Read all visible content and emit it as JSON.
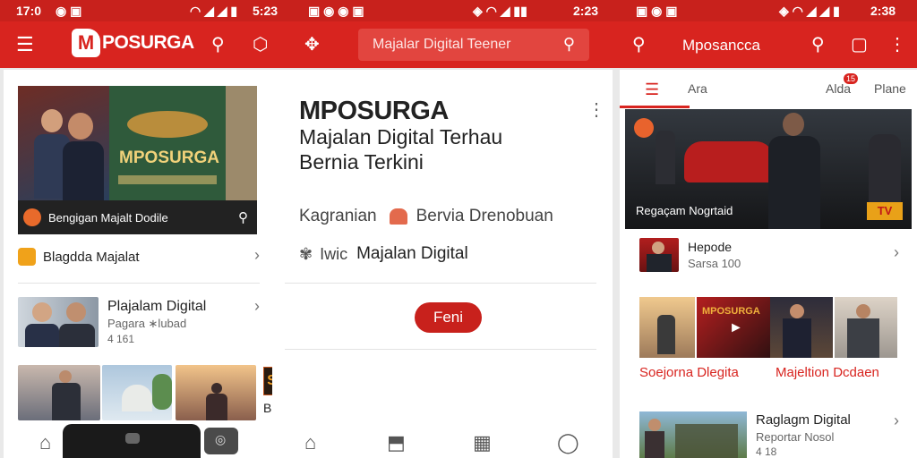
{
  "status_bar": {
    "left_time": "17:0",
    "left_clock": "5:23",
    "right_clock": "2:38",
    "mid_clock": "2:23"
  },
  "colors": {
    "brand": "#d8241f",
    "status": "#c8211c",
    "search_bg": "#e2453f"
  },
  "app_bar": {
    "brand_name": "POSURGA",
    "brand_mark": "M",
    "search_placeholder": "Majalar Digital Teener",
    "right_title": "Mposancca"
  },
  "left_panel": {
    "hero_caption": "Bengigan Majalt Dodile",
    "hero_title": "MPOSURGA",
    "section_1": {
      "label": "Blagdda Majalat"
    },
    "item_1": {
      "title": "Plajalam Digital",
      "subtitle": "Pagara ∗lubad",
      "meta": "4 161"
    },
    "last_label": "Bornen",
    "sovf": "SOVF"
  },
  "center_panel": {
    "title": "MPOSURGA",
    "subtitle_1": "Majalan Digital Terhau",
    "subtitle_2": "Bernia Terkini",
    "row_1_left": "Kagranian",
    "row_1_right": "Bervia Drenobuan",
    "row_2_left": "Iwic",
    "row_2_right": "Majalan Digital",
    "button": "Feni"
  },
  "right_panel": {
    "tabs": {
      "tab1": "Ara",
      "tab2": "Alda",
      "tab3": "Plane",
      "badge": "15"
    },
    "hero_caption": "Regaçam Nogrtaid",
    "hero_badge": "TV",
    "item_1": {
      "title": "Hepode",
      "subtitle": "Sarsa 100"
    },
    "caption_left": "Soejorna Dlegita",
    "caption_right": "Majeltion Dcdaen",
    "item_2": {
      "title": "Raglagm Digital",
      "subtitle": "Reportar Nosol",
      "meta": "4 18"
    }
  }
}
